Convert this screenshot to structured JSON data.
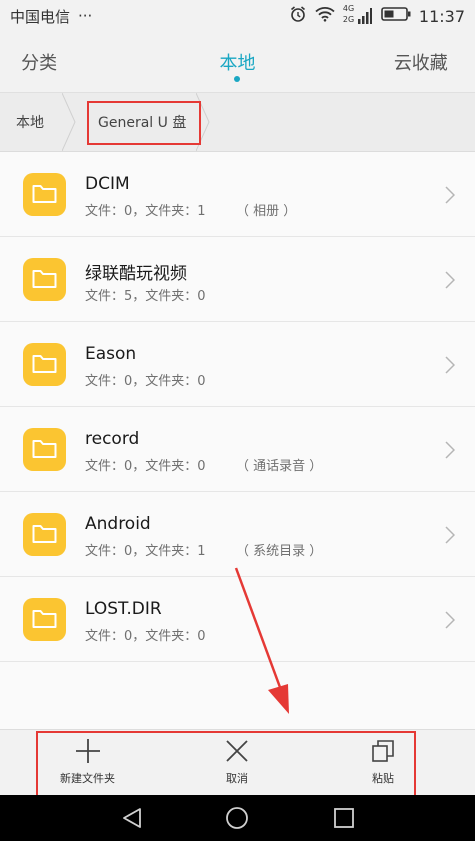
{
  "status": {
    "carrier": "中国电信",
    "dots": "···",
    "net_top": "4G",
    "net_bottom": "2G",
    "time": "11:37"
  },
  "tabs": [
    {
      "label": "分类",
      "active": false
    },
    {
      "label": "本地",
      "active": true
    },
    {
      "label": "云收藏",
      "active": false
    }
  ],
  "breadcrumb": [
    "本地",
    "General U 盘"
  ],
  "folders": [
    {
      "name": "DCIM",
      "meta": "文件：0，文件夹：1",
      "tag": "（ 相册 ）"
    },
    {
      "name": "绿联酷玩视频",
      "meta": "文件：5，文件夹：0",
      "tag": ""
    },
    {
      "name": "Eason",
      "meta": "文件：0，文件夹：0",
      "tag": ""
    },
    {
      "name": "record",
      "meta": "文件：0，文件夹：0",
      "tag": "（ 通话录音 ）"
    },
    {
      "name": "Android",
      "meta": "文件：0，文件夹：1",
      "tag": "（ 系统目录 ）"
    },
    {
      "name": "LOST.DIR",
      "meta": "文件：0，文件夹：0",
      "tag": ""
    }
  ],
  "toolbar": {
    "new_folder": "新建文件夹",
    "cancel": "取消",
    "paste": "粘贴"
  },
  "colors": {
    "accent": "#1aa7c3",
    "folder": "#fbc531",
    "highlight": "#e53935"
  }
}
